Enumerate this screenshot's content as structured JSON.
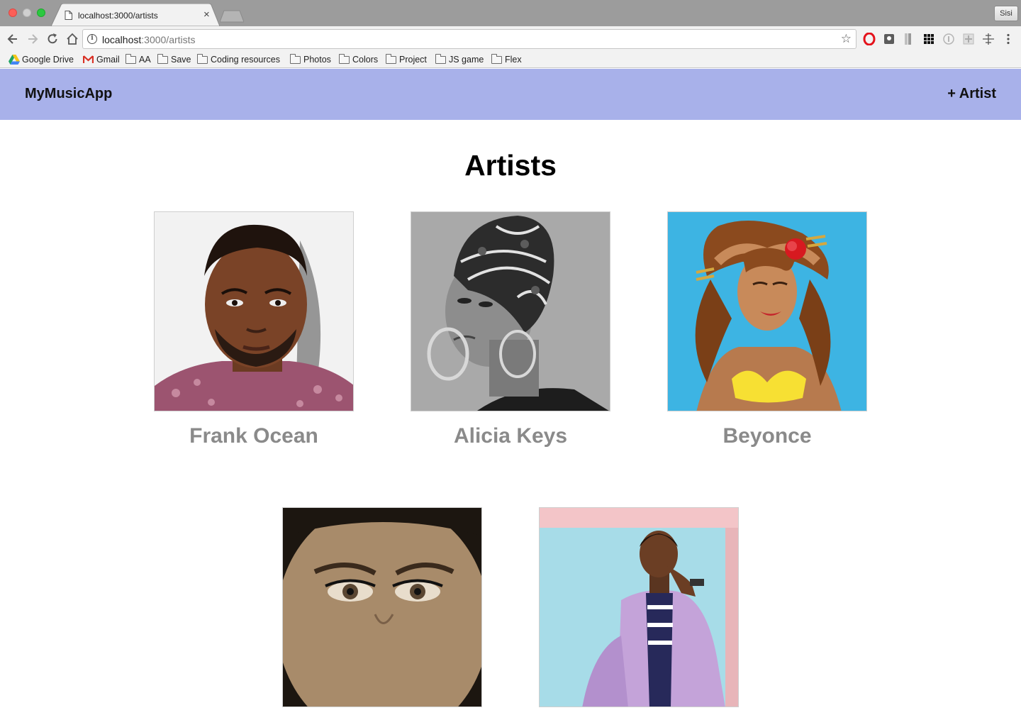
{
  "browser": {
    "tab_title": "localhost:3000/artists",
    "tab_close": "×",
    "profile_label": "Sisi",
    "url_host": "localhost",
    "url_path": ":3000/artists",
    "bookmarks": [
      "Google Drive",
      "Gmail",
      "AA",
      "Save",
      "Coding resources",
      "Photos",
      "Colors",
      "Project",
      "JS game",
      "Flex"
    ]
  },
  "app": {
    "brand": "MyMusicApp",
    "add_artist_label": "+ Artist",
    "page_title": "Artists",
    "nav_color": "#a8b1ea",
    "artists": [
      {
        "name": "Frank Ocean"
      },
      {
        "name": "Alicia Keys"
      },
      {
        "name": "Beyonce"
      },
      {
        "name": ""
      },
      {
        "name": ""
      }
    ]
  }
}
